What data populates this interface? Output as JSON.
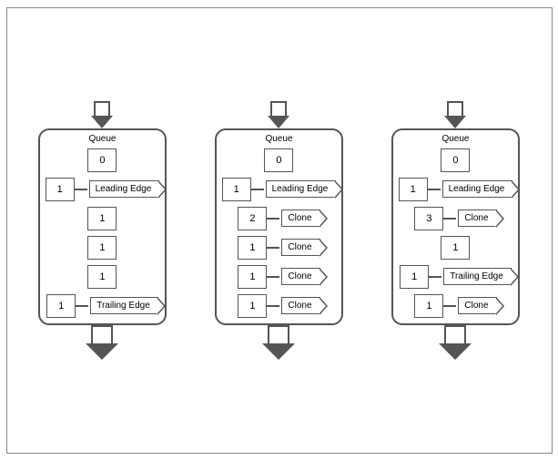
{
  "diagrams": [
    {
      "id": "diagram1",
      "queue_label": "Queue",
      "cells": [
        {
          "value": "0",
          "label": null
        },
        {
          "value": "1",
          "label": "Leading Edge"
        },
        {
          "value": "1",
          "label": null
        },
        {
          "value": "1",
          "label": null
        },
        {
          "value": "1",
          "label": null
        },
        {
          "value": "1",
          "label": "Trailing Edge"
        }
      ]
    },
    {
      "id": "diagram2",
      "queue_label": "Queue",
      "cells": [
        {
          "value": "0",
          "label": null
        },
        {
          "value": "1",
          "label": "Leading Edge"
        },
        {
          "value": "2",
          "label": "Clone"
        },
        {
          "value": "1",
          "label": "Clone"
        },
        {
          "value": "1",
          "label": "Clone"
        },
        {
          "value": "1",
          "label": "Clone"
        }
      ]
    },
    {
      "id": "diagram3",
      "queue_label": "Queue",
      "cells": [
        {
          "value": "0",
          "label": null
        },
        {
          "value": "1",
          "label": "Leading Edge"
        },
        {
          "value": "3",
          "label": "Clone"
        },
        {
          "value": "1",
          "label": null
        },
        {
          "value": "1",
          "label": "Trailing Edge"
        },
        {
          "value": "1",
          "label": "Clone"
        }
      ]
    }
  ]
}
